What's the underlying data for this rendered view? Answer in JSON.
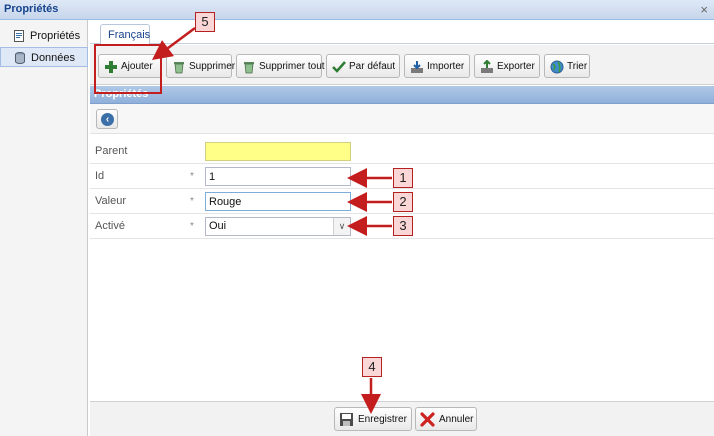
{
  "window": {
    "title": "Propriétés",
    "close_symbol": "×"
  },
  "nav": {
    "items": [
      {
        "label": "Propriétés",
        "icon": "document-icon",
        "active": false
      },
      {
        "label": "Données",
        "icon": "database-icon",
        "active": true
      }
    ]
  },
  "tabs": [
    {
      "label": "Français"
    }
  ],
  "toolbar": {
    "add": "Ajouter",
    "delete": "Supprimer",
    "delete_all": "Supprimer tout",
    "default": "Par défaut",
    "import": "Importer",
    "export": "Exporter",
    "sort": "Trier"
  },
  "section": {
    "title": "Propriétés"
  },
  "form": {
    "fields": [
      {
        "label": "Parent",
        "value": "",
        "required": false
      },
      {
        "label": "Id",
        "value": "1",
        "required": true
      },
      {
        "label": "Valeur",
        "value": "Rouge",
        "required": true
      },
      {
        "label": "Activé",
        "value": "Oui",
        "required": true
      }
    ],
    "required_marker": "*"
  },
  "footer": {
    "save": "Enregistrer",
    "cancel": "Annuler"
  },
  "annotations": [
    "1",
    "2",
    "3",
    "4",
    "5"
  ],
  "colors": {
    "header_blue": "#8fb0db",
    "annotation_red": "#c41d1d",
    "highlight_yellow": "#ffff88"
  }
}
